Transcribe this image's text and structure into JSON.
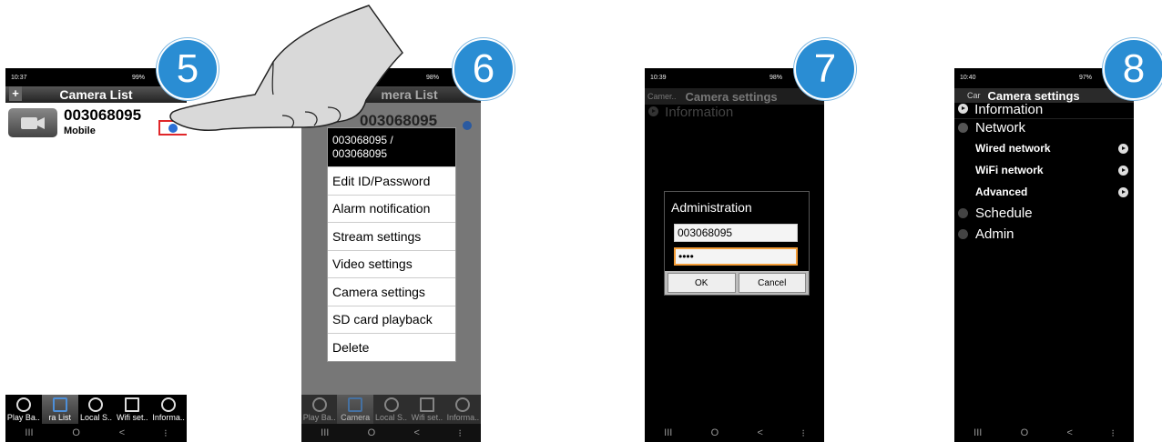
{
  "steps": [
    "5",
    "6",
    "7",
    "8"
  ],
  "nav": {
    "recent": "III",
    "home": "O",
    "back": "<",
    "extra": "⁝"
  },
  "screen5": {
    "time": "10:37",
    "status": "99%",
    "title": "Camera List",
    "add": "+",
    "camera_id": "003068095",
    "camera_type": "Mobile"
  },
  "screen6": {
    "status": "98%",
    "title": "mera List",
    "camera_id": "003068095",
    "menu_header": "003068095 / 003068095",
    "menu": [
      "Edit ID/Password",
      "Alarm notification",
      "Stream settings",
      "Video settings",
      "Camera settings",
      "SD card playback",
      "Delete"
    ]
  },
  "tabs5": [
    "Play Ba..",
    "ra List",
    "Local S..",
    "Wifi set..",
    "Informa.."
  ],
  "tabs6": [
    "Play Ba..",
    "Camera",
    "Local S..",
    "Wifi set..",
    "Informa.."
  ],
  "screen7": {
    "time": "10:39",
    "status": "98%",
    "back_label": "Camer..",
    "title": "Camera settings",
    "info": "Information",
    "dialog_title": "Administration",
    "id_value": "003068095",
    "password": "••••",
    "ok": "OK",
    "cancel": "Cancel"
  },
  "screen8": {
    "time": "10:40",
    "status": "97%",
    "back_label": "Car",
    "title": "Camera settings",
    "info": "Information",
    "network": "Network",
    "wired": "Wired network",
    "wifi": "WiFi network",
    "advanced": "Advanced",
    "schedule": "Schedule",
    "admin": "Admin"
  }
}
